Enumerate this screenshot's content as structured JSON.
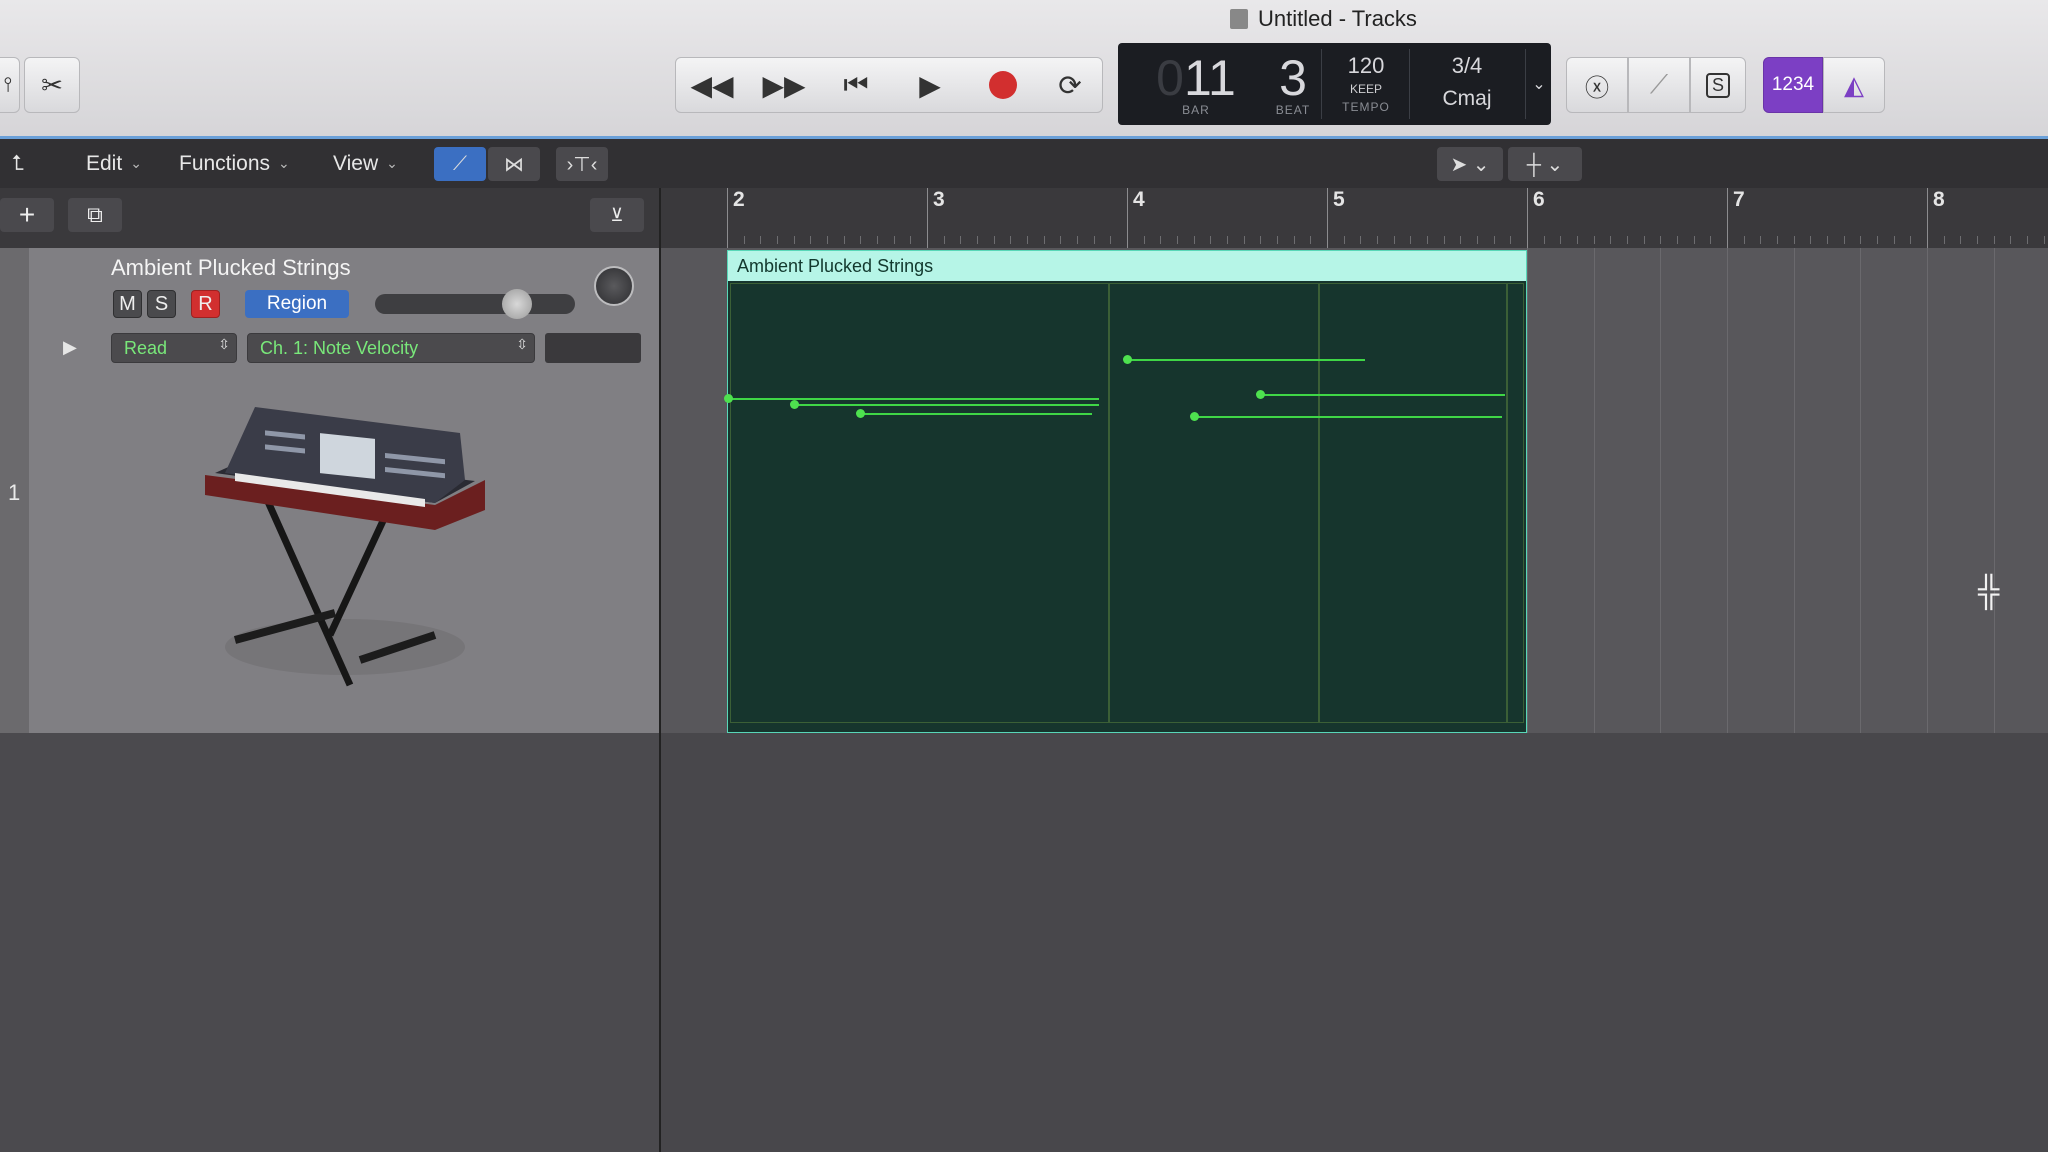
{
  "window": {
    "title": "Untitled - Tracks"
  },
  "lcd": {
    "bar": "11",
    "beat": "3",
    "bar_label": "BAR",
    "beat_label": "BEAT",
    "tempo": "120",
    "tempo_mode": "KEEP",
    "tempo_label": "TEMPO",
    "signature": "3/4",
    "key": "Cmaj"
  },
  "toolbar": {
    "edit": "Edit",
    "functions": "Functions",
    "view": "View",
    "count_in": "1234"
  },
  "ruler": {
    "bars": [
      "2",
      "3",
      "4",
      "5",
      "6",
      "7",
      "8"
    ]
  },
  "track": {
    "number": "1",
    "name": "Ambient Plucked Strings",
    "mute": "M",
    "solo": "S",
    "record": "R",
    "region_button": "Region",
    "automation_mode": "Read",
    "automation_param": "Ch. 1: Note Velocity"
  },
  "region": {
    "name": "Ambient Plucked Strings"
  },
  "colors": {
    "region_header": "#b6f5e7",
    "region_body": "#16352d",
    "automation": "#3fd646",
    "record": "#d22f2f",
    "count_in": "#7c3fc4"
  }
}
